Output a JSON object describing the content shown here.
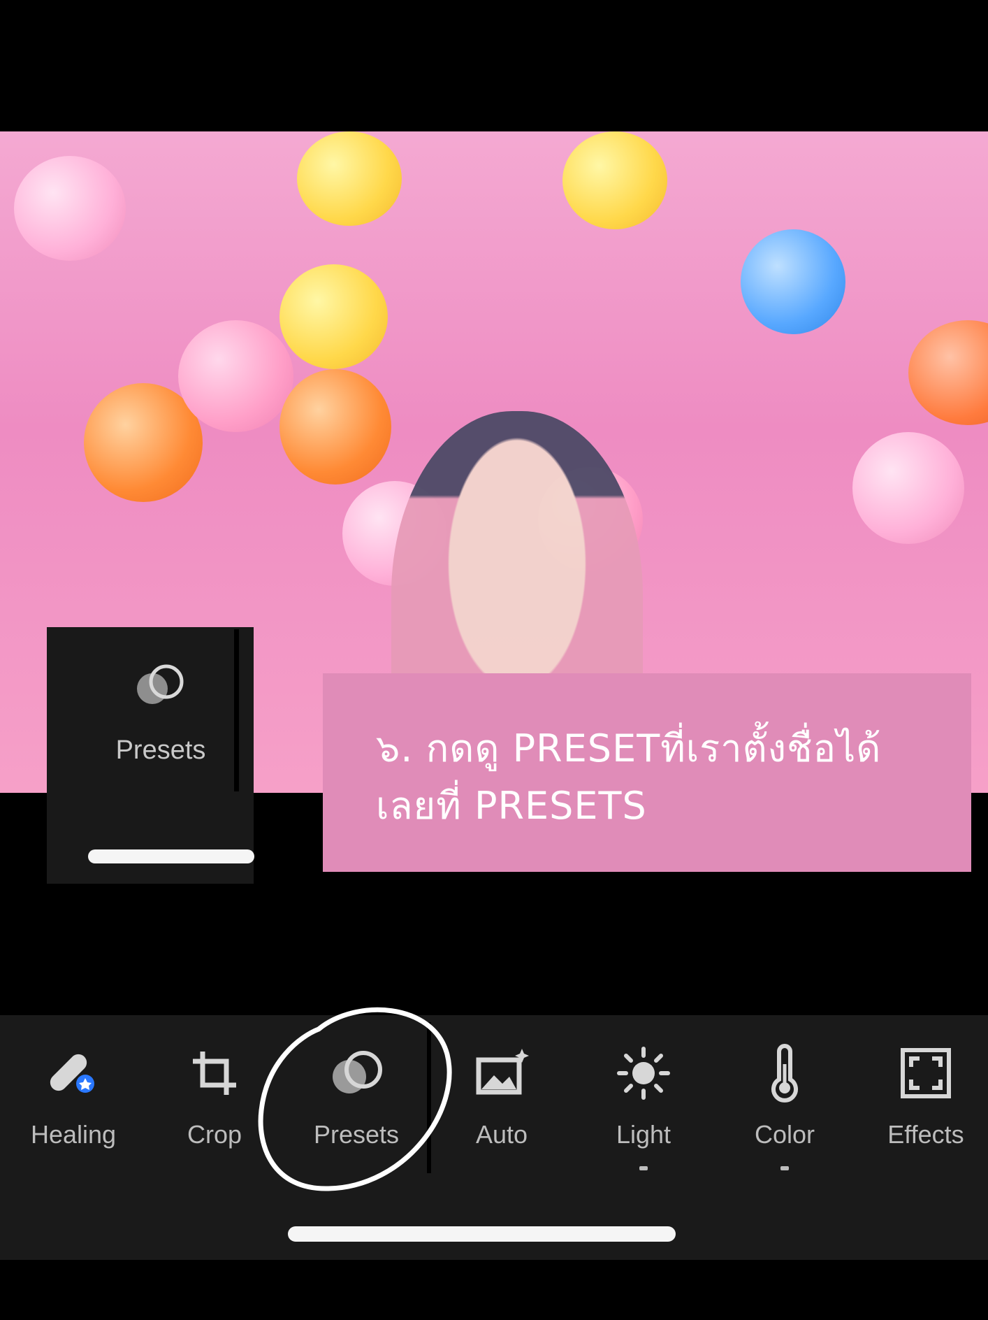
{
  "photo": {
    "balls": [
      {
        "color": "#ffd84a"
      },
      {
        "color": "#ffb0d8"
      },
      {
        "color": "#ff8a35"
      },
      {
        "color": "#ffd84a"
      },
      {
        "color": "#ff9fc8"
      },
      {
        "color": "#58a8ff"
      },
      {
        "color": "#ff8a35"
      },
      {
        "color": "#ffb0d8"
      },
      {
        "color": "#ff9fc8"
      },
      {
        "color": "#ff7b3e"
      },
      {
        "color": "#ffb0d8"
      },
      {
        "color": "#ffd84a"
      }
    ]
  },
  "zoom_card": {
    "label": "Presets",
    "icon": "presets-icon"
  },
  "caption": {
    "line1": "๖. กดดู PRESETที่เราตั้งชื่อได้",
    "line2": "เลยที่  PRESETS"
  },
  "toolbar": {
    "items": [
      {
        "label": "Healing",
        "icon": "healing-icon",
        "has_dot": false
      },
      {
        "label": "Crop",
        "icon": "crop-icon",
        "has_dot": false
      },
      {
        "label": "Presets",
        "icon": "presets-icon",
        "has_dot": false
      },
      {
        "label": "Auto",
        "icon": "auto-icon",
        "has_dot": false
      },
      {
        "label": "Light",
        "icon": "light-icon",
        "has_dot": true
      },
      {
        "label": "Color",
        "icon": "color-icon",
        "has_dot": true
      },
      {
        "label": "Effects",
        "icon": "effects-icon",
        "has_dot": false
      }
    ]
  },
  "colors": {
    "caption_bg": "#e08cb8",
    "toolbar_bg": "#1a1a1a",
    "accent_blue": "#2a78ff"
  }
}
